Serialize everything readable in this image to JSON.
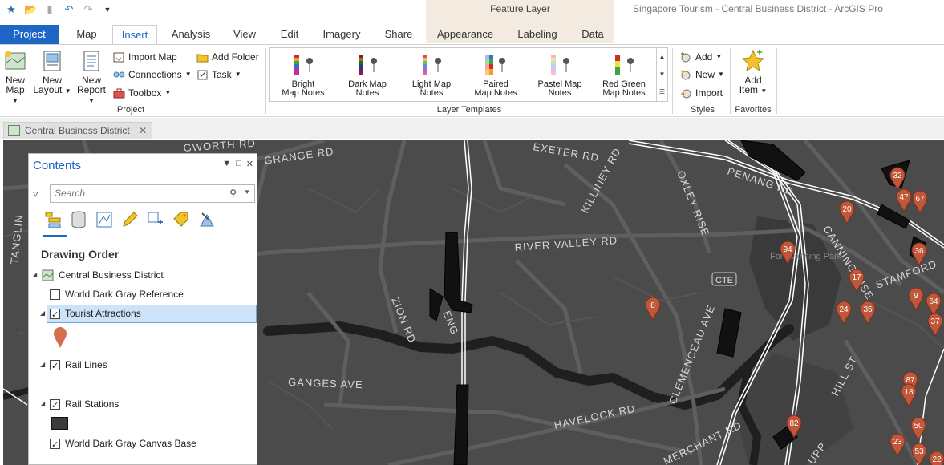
{
  "app": {
    "title": "Singapore Tourism - Central Business District - ArcGIS Pro",
    "context_group": "Feature Layer"
  },
  "tabs": [
    {
      "label": "Project"
    },
    {
      "label": "Map"
    },
    {
      "label": "Insert"
    },
    {
      "label": "Analysis"
    },
    {
      "label": "View"
    },
    {
      "label": "Edit"
    },
    {
      "label": "Imagery"
    },
    {
      "label": "Share"
    },
    {
      "label": "Appearance"
    },
    {
      "label": "Labeling"
    },
    {
      "label": "Data"
    }
  ],
  "ribbon": {
    "project": {
      "new_map": "New Map",
      "new_layout": "New Layout",
      "new_report": "New Report",
      "import_map": "Import Map",
      "connections": "Connections",
      "toolbox": "Toolbox",
      "add_folder": "Add Folder",
      "task": "Task",
      "label": "Project"
    },
    "layer_templates": {
      "items": [
        {
          "line1": "Bright",
          "line2": "Map Notes"
        },
        {
          "line1": "Dark Map",
          "line2": "Notes"
        },
        {
          "line1": "Light Map",
          "line2": "Notes"
        },
        {
          "line1": "Paired",
          "line2": "Map Notes"
        },
        {
          "line1": "Pastel Map",
          "line2": "Notes"
        },
        {
          "line1": "Red Green",
          "line2": "Map Notes"
        }
      ],
      "label": "Layer Templates"
    },
    "styles": {
      "add": "Add",
      "new": "New",
      "import": "Import",
      "label": "Styles"
    },
    "favorites": {
      "add_item": "Add Item",
      "label": "Favorites"
    }
  },
  "view_tab": {
    "label": "Central Business District"
  },
  "contents": {
    "title": "Contents",
    "search_placeholder": "Search",
    "drawing_order": "Drawing Order",
    "map_name": "Central Business District",
    "layers": [
      {
        "name": "World Dark Gray Reference",
        "checked": false
      },
      {
        "name": "Tourist Attractions",
        "checked": true
      },
      {
        "name": "Rail Lines",
        "checked": true
      },
      {
        "name": "Rail Stations",
        "checked": true
      },
      {
        "name": "World Dark Gray Canvas Base",
        "checked": true
      }
    ]
  },
  "map": {
    "road_labels": [
      "GRANGE RD",
      "EXETER RD",
      "KILLINEY RD",
      "OXLEY RISE",
      "PENANG RD",
      "RIVER VALLEY RD",
      "ZION RD",
      "CTE",
      "CLEMENCEAU AVE",
      "GANGES AVE",
      "HAVELOCK RD",
      "MERCHANT RD",
      "TANGLIN",
      "CANNING RISE",
      "STAMFORD",
      "HILL ST",
      "UPP",
      "GWORTH RD",
      "Fort Canning Park",
      "ENG"
    ],
    "poi_ids": [
      "8",
      "94",
      "20",
      "32",
      "47",
      "67",
      "36",
      "17",
      "24",
      "35",
      "9",
      "64",
      "37",
      "87",
      "18",
      "82",
      "50",
      "23",
      "53",
      "22"
    ],
    "colors": {
      "poi": "#c0563a",
      "water": "#1f1f1f",
      "land": "#4b4b4b",
      "road": "#5d5d5d"
    }
  }
}
